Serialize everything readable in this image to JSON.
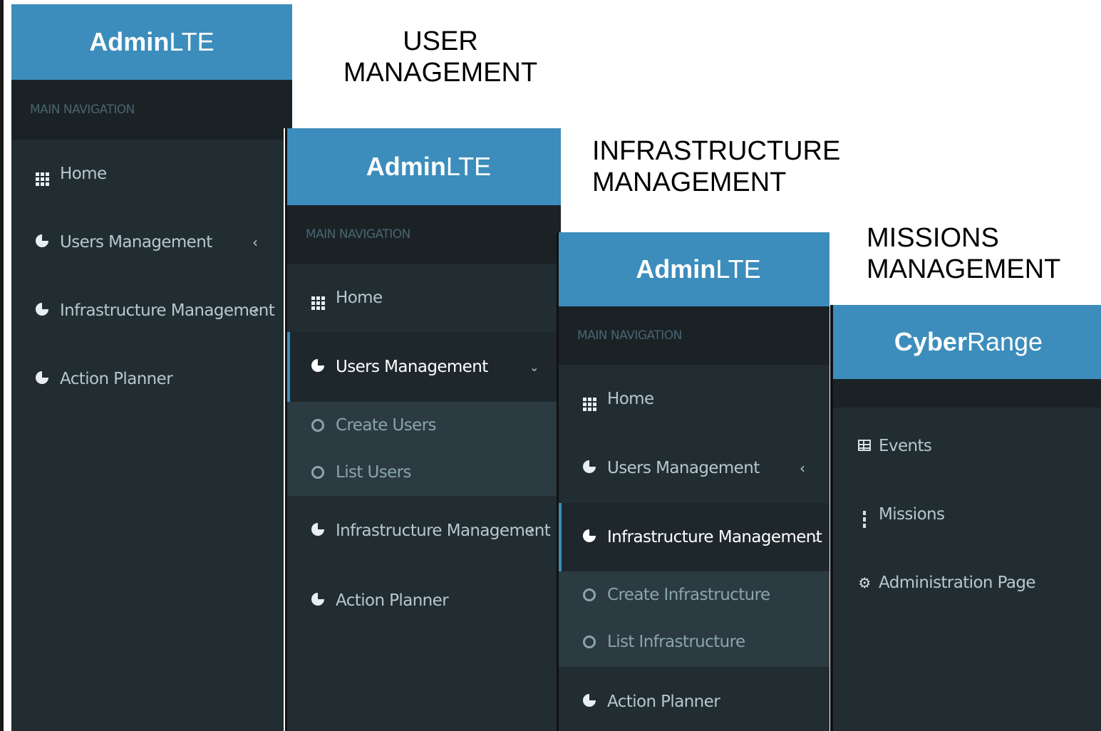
{
  "captions": {
    "user": [
      "USER",
      "MANAGEMENT"
    ],
    "infra": [
      "INFRASTRUCTURE",
      "MANAGEMENT"
    ],
    "missions": [
      "MISSIONS",
      "MANAGEMENT"
    ]
  },
  "panel1": {
    "brand_bold": "Admin",
    "brand_light": "LTE",
    "nav_header": "MAIN NAVIGATION",
    "items": [
      "Home",
      "Users Management",
      "Infrastructure Management",
      "Action Planner"
    ]
  },
  "panel2": {
    "brand_bold": "Admin",
    "brand_light": "LTE",
    "nav_header": "MAIN NAVIGATION",
    "items": [
      "Home",
      "Users Management",
      "Infrastructure Management",
      "Action Planner"
    ],
    "submenu": [
      "Create Users",
      "List Users"
    ]
  },
  "panel3": {
    "brand_bold": "Admin",
    "brand_light": "LTE",
    "nav_header": "MAIN NAVIGATION",
    "items": [
      "Home",
      "Users Management",
      "Infrastructure Management",
      "Action Planner"
    ],
    "submenu": [
      "Create Infrastructure",
      "List Infrastructure"
    ]
  },
  "panel4": {
    "brand_bold": "Cyber",
    "brand_light": "Range",
    "items": [
      "Events",
      "Missions",
      "Administration Page"
    ]
  },
  "colors": {
    "brand": "#3c8dbc",
    "sidebar": "#222d32",
    "header": "#1a2226",
    "submenu": "#2c3b41"
  }
}
